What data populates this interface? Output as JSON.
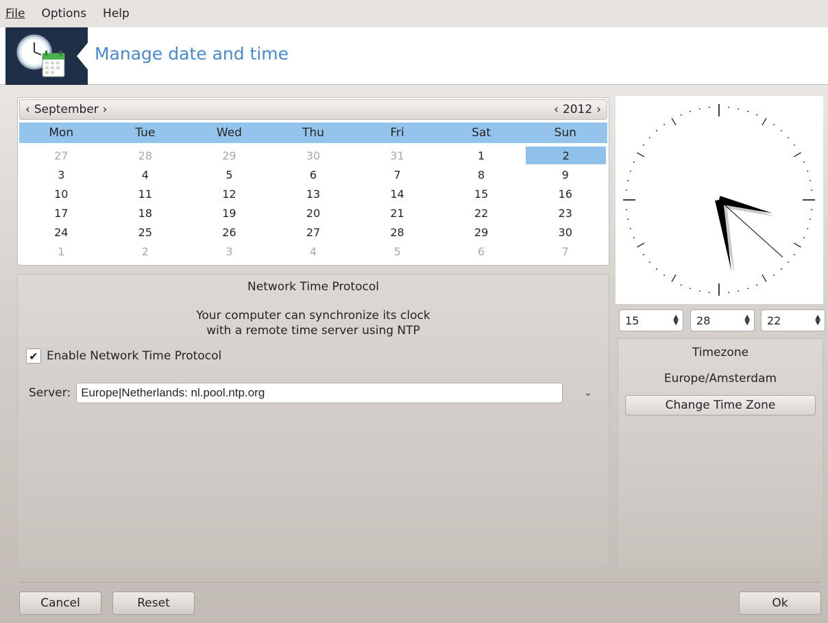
{
  "menu": {
    "items": [
      {
        "label": "File"
      },
      {
        "label": "Options"
      },
      {
        "label": "Help"
      }
    ]
  },
  "header": {
    "title": "Manage date and time",
    "logo_icon": "clock-calendar-icon"
  },
  "calendar": {
    "month": "September",
    "year": "2012",
    "weekdays": [
      "Mon",
      "Tue",
      "Wed",
      "Thu",
      "Fri",
      "Sat",
      "Sun"
    ],
    "selected_day": "2",
    "weeks": [
      [
        "27",
        "28",
        "29",
        "30",
        "31",
        "1",
        "2"
      ],
      [
        "3",
        "4",
        "5",
        "6",
        "7",
        "8",
        "9"
      ],
      [
        "10",
        "11",
        "12",
        "13",
        "14",
        "15",
        "16"
      ],
      [
        "17",
        "18",
        "19",
        "20",
        "21",
        "22",
        "23"
      ],
      [
        "24",
        "25",
        "26",
        "27",
        "28",
        "29",
        "30"
      ],
      [
        "1",
        "2",
        "3",
        "4",
        "5",
        "6",
        "7"
      ]
    ]
  },
  "time": {
    "hour": "15",
    "minute": "28",
    "second": "22"
  },
  "ntp": {
    "title": "Network Time Protocol",
    "description_line1": "Your computer can synchronize its clock",
    "description_line2": "with a remote time server using NTP",
    "enable_label": "Enable Network Time Protocol",
    "enabled": true,
    "server_label": "Server:",
    "server_value": "Europe|Netherlands: nl.pool.ntp.org"
  },
  "timezone": {
    "title": "Timezone",
    "value": "Europe/Amsterdam",
    "change_button": "Change Time Zone"
  },
  "buttons": {
    "cancel": "Cancel",
    "reset": "Reset",
    "ok": "Ok"
  },
  "colors": {
    "accent": "#4a88c9",
    "selection": "#8fc1ea",
    "header_logo_bg": "#1f2f47"
  }
}
